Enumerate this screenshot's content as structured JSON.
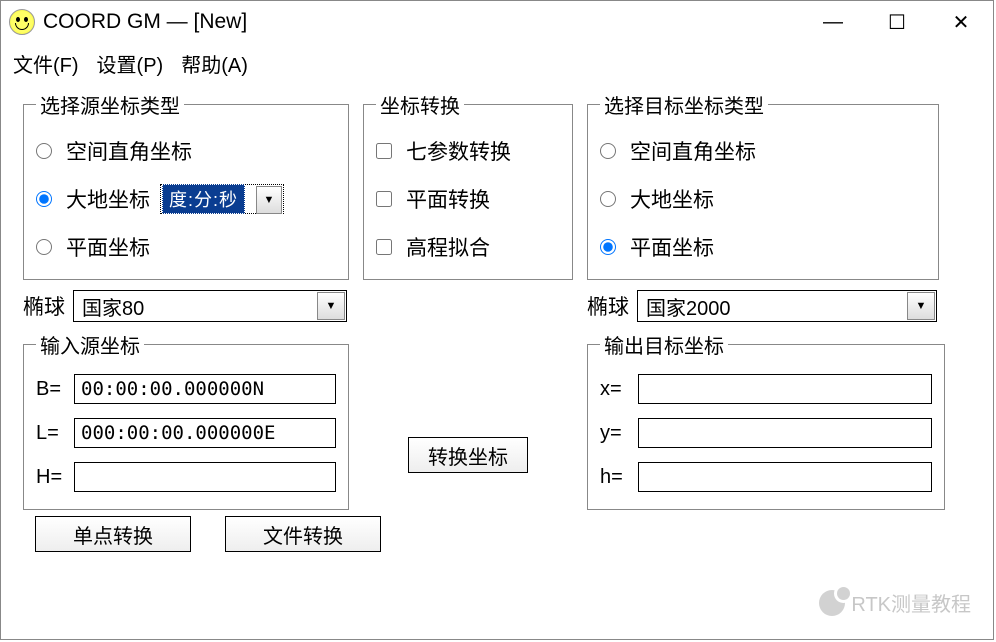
{
  "window": {
    "title": "COORD GM — [New]"
  },
  "menu": {
    "file": "文件(F)",
    "settings": "设置(P)",
    "help": "帮助(A)"
  },
  "src_type": {
    "legend": "选择源坐标类型",
    "opt_cartesian": "空间直角坐标",
    "opt_geodetic": "大地坐标",
    "opt_plane": "平面坐标",
    "format_selected": "度:分:秒"
  },
  "transform": {
    "legend": "坐标转换",
    "chk_seven": "七参数转换",
    "chk_plane": "平面转换",
    "chk_height": "高程拟合"
  },
  "dst_type": {
    "legend": "选择目标坐标类型",
    "opt_cartesian": "空间直角坐标",
    "opt_geodetic": "大地坐标",
    "opt_plane": "平面坐标"
  },
  "ellipsoid": {
    "label": "椭球",
    "src": "国家80",
    "dst": "国家2000"
  },
  "input": {
    "legend": "输入源坐标",
    "b_label": "B=",
    "b_value": "00:00:00.000000N",
    "l_label": "L=",
    "l_value": "000:00:00.000000E",
    "h_label": "H=",
    "h_value": ""
  },
  "output": {
    "legend": "输出目标坐标",
    "x_label": "x=",
    "x_value": "",
    "y_label": "y=",
    "y_value": "",
    "h_label": "h=",
    "h_value": ""
  },
  "buttons": {
    "convert": "转换坐标",
    "single": "单点转换",
    "file": "文件转换"
  },
  "watermark": "RTK测量教程"
}
